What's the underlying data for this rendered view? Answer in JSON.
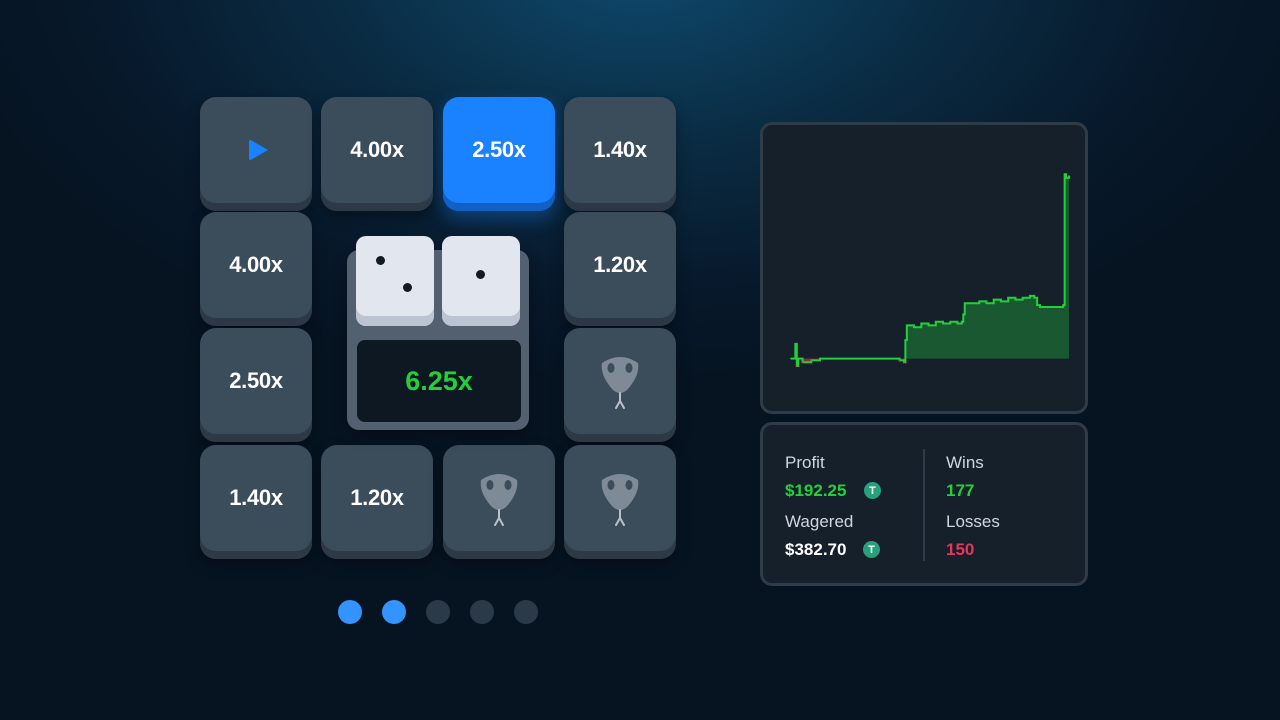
{
  "board": {
    "tiles": [
      {
        "label": "",
        "type": "play"
      },
      {
        "label": "4.00x",
        "type": "multiplier"
      },
      {
        "label": "2.50x",
        "type": "multiplier",
        "active": true
      },
      {
        "label": "1.40x",
        "type": "multiplier"
      },
      {
        "label": "4.00x",
        "type": "multiplier"
      },
      {
        "label": "1.20x",
        "type": "multiplier"
      },
      {
        "label": "2.50x",
        "type": "multiplier"
      },
      {
        "label": "",
        "type": "snake"
      },
      {
        "label": "1.40x",
        "type": "multiplier"
      },
      {
        "label": "1.20x",
        "type": "multiplier"
      },
      {
        "label": "",
        "type": "snake"
      },
      {
        "label": "",
        "type": "snake"
      }
    ],
    "dice": [
      2,
      1
    ],
    "result": "6.25x"
  },
  "pagination": {
    "total": 5,
    "active": [
      0,
      1
    ]
  },
  "stats": {
    "profit_label": "Profit",
    "profit_value": "$192.25",
    "wagered_label": "Wagered",
    "wagered_value": "$382.70",
    "wins_label": "Wins",
    "wins_value": "177",
    "losses_label": "Losses",
    "losses_value": "150",
    "currency_icon": "tether-icon",
    "currency_symbol": "T"
  },
  "colors": {
    "accent": "#1a82ff",
    "profit": "#22d13a",
    "loss": "#e8345a"
  },
  "chart_data": {
    "type": "area",
    "title": "",
    "xlabel": "",
    "ylabel": "",
    "grid": false,
    "x": [
      0,
      2,
      3,
      4,
      5,
      8,
      14,
      20,
      25,
      30,
      35,
      40,
      45,
      50,
      55,
      60,
      65,
      70,
      75,
      78,
      79,
      80,
      85,
      90,
      95,
      100,
      105,
      110,
      115,
      118,
      119,
      120,
      125,
      130,
      135,
      140,
      145,
      150,
      155,
      160,
      165,
      168,
      170,
      172,
      175,
      180,
      185,
      188,
      189,
      190,
      192
    ],
    "values": [
      0,
      0,
      8,
      -4,
      0,
      -2,
      -1,
      0,
      0,
      0,
      0,
      0,
      0,
      0,
      0,
      0,
      0,
      0,
      -1,
      -2,
      10,
      18,
      17,
      19,
      18,
      20,
      19,
      20,
      19,
      20,
      24,
      30,
      30,
      31,
      30,
      32,
      31,
      33,
      32,
      33,
      34,
      33,
      29,
      28,
      28,
      28,
      28,
      29,
      100,
      98,
      99
    ],
    "ylim": [
      -10,
      105
    ]
  }
}
